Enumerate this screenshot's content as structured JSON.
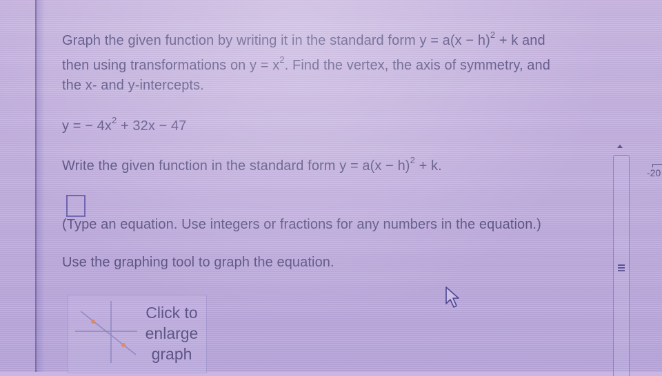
{
  "question": {
    "line1_pre": "Graph the given function by writing it in the standard form y = a(x − h)",
    "line1_sup": "2",
    "line1_post": " + k and",
    "line2_pre": "then using transformations on y = x",
    "line2_sup": "2",
    "line2_post": ". Find the vertex, the axis of symmetry, and",
    "line3": "the x- and y-intercepts."
  },
  "function": {
    "pre": "y = − 4x",
    "sup": "2",
    "post": " + 32x − 47"
  },
  "instruction": {
    "pre": "Write the given function in the standard form y = a(x − h)",
    "sup": "2",
    "post": " + k."
  },
  "answer": {
    "value": "",
    "hint": "(Type an equation. Use integers or fractions for any numbers in the equation.)"
  },
  "graph": {
    "prompt": "Use the graphing tool to graph the equation.",
    "thumbnail_label_line1": "Click to",
    "thumbnail_label_line2": "enlarge",
    "thumbnail_label_line3": "graph",
    "point_color": "#e08a6a",
    "axis_color": "#8f88c4"
  },
  "side_panel": {
    "axis_label": "-20",
    "scroll_up_icon": "triangle-up-icon",
    "grip_icon": "grip-lines-icon"
  }
}
